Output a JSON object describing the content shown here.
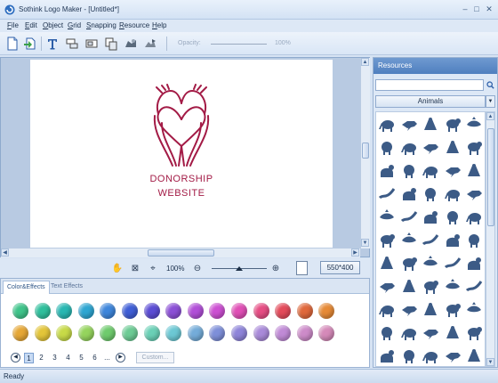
{
  "window": {
    "title": "Sothink Logo Maker - [Untitled*]"
  },
  "menu": [
    {
      "key": "F",
      "rest": "ile"
    },
    {
      "key": "E",
      "rest": "dit"
    },
    {
      "key": "O",
      "rest": "bject"
    },
    {
      "key": "G",
      "rest": "rid"
    },
    {
      "key": "S",
      "rest": "napping"
    },
    {
      "key": "R",
      "rest": "esource"
    },
    {
      "key": "H",
      "rest": "elp"
    }
  ],
  "toolbar": {
    "icons": [
      "new-file-icon",
      "open-icon",
      "text-icon",
      "align-icon",
      "group-icon",
      "ungroup-icon",
      "front-icon",
      "back-icon"
    ],
    "opacity_label": "Opacity",
    "opacity_value": "100%"
  },
  "logo": {
    "line1": "DONORSHIP",
    "line2": "WEBSITE",
    "color": "#a31b46"
  },
  "zoom": {
    "value": "100%",
    "size": "550*400"
  },
  "effects": {
    "tabs": [
      "Color&Effects",
      "Text Effects"
    ],
    "active_tab": "Color&Effects",
    "swatches_row1": [
      "#3fc48a",
      "#2fbf9c",
      "#28b7b2",
      "#2ea6d2",
      "#3e86db",
      "#3f5ed6",
      "#5b4cd4",
      "#8b4fd6",
      "#b14fd8",
      "#cc4fd2",
      "#e04fb6",
      "#e64d84",
      "#e34a5a",
      "#e0683b",
      "#e68a36"
    ],
    "swatches_row2": [
      "#e6a735",
      "#e3c539",
      "#c7da47",
      "#95d45d",
      "#6fcb6d",
      "#6ccb94",
      "#6ad0b6",
      "#6cc8d4",
      "#74acd9",
      "#7e8fd9",
      "#8e84d9",
      "#a98ad9",
      "#c08ad6",
      "#cd8bc9",
      "#d58ab9"
    ],
    "pages": [
      "1",
      "2",
      "3",
      "4",
      "5",
      "6",
      "..."
    ],
    "active_page": "1",
    "custom_label": "Custom..."
  },
  "resources": {
    "header": "Resources",
    "category": "Animals",
    "icon_color": "#3c5b86"
  },
  "status": {
    "text": "Ready"
  }
}
